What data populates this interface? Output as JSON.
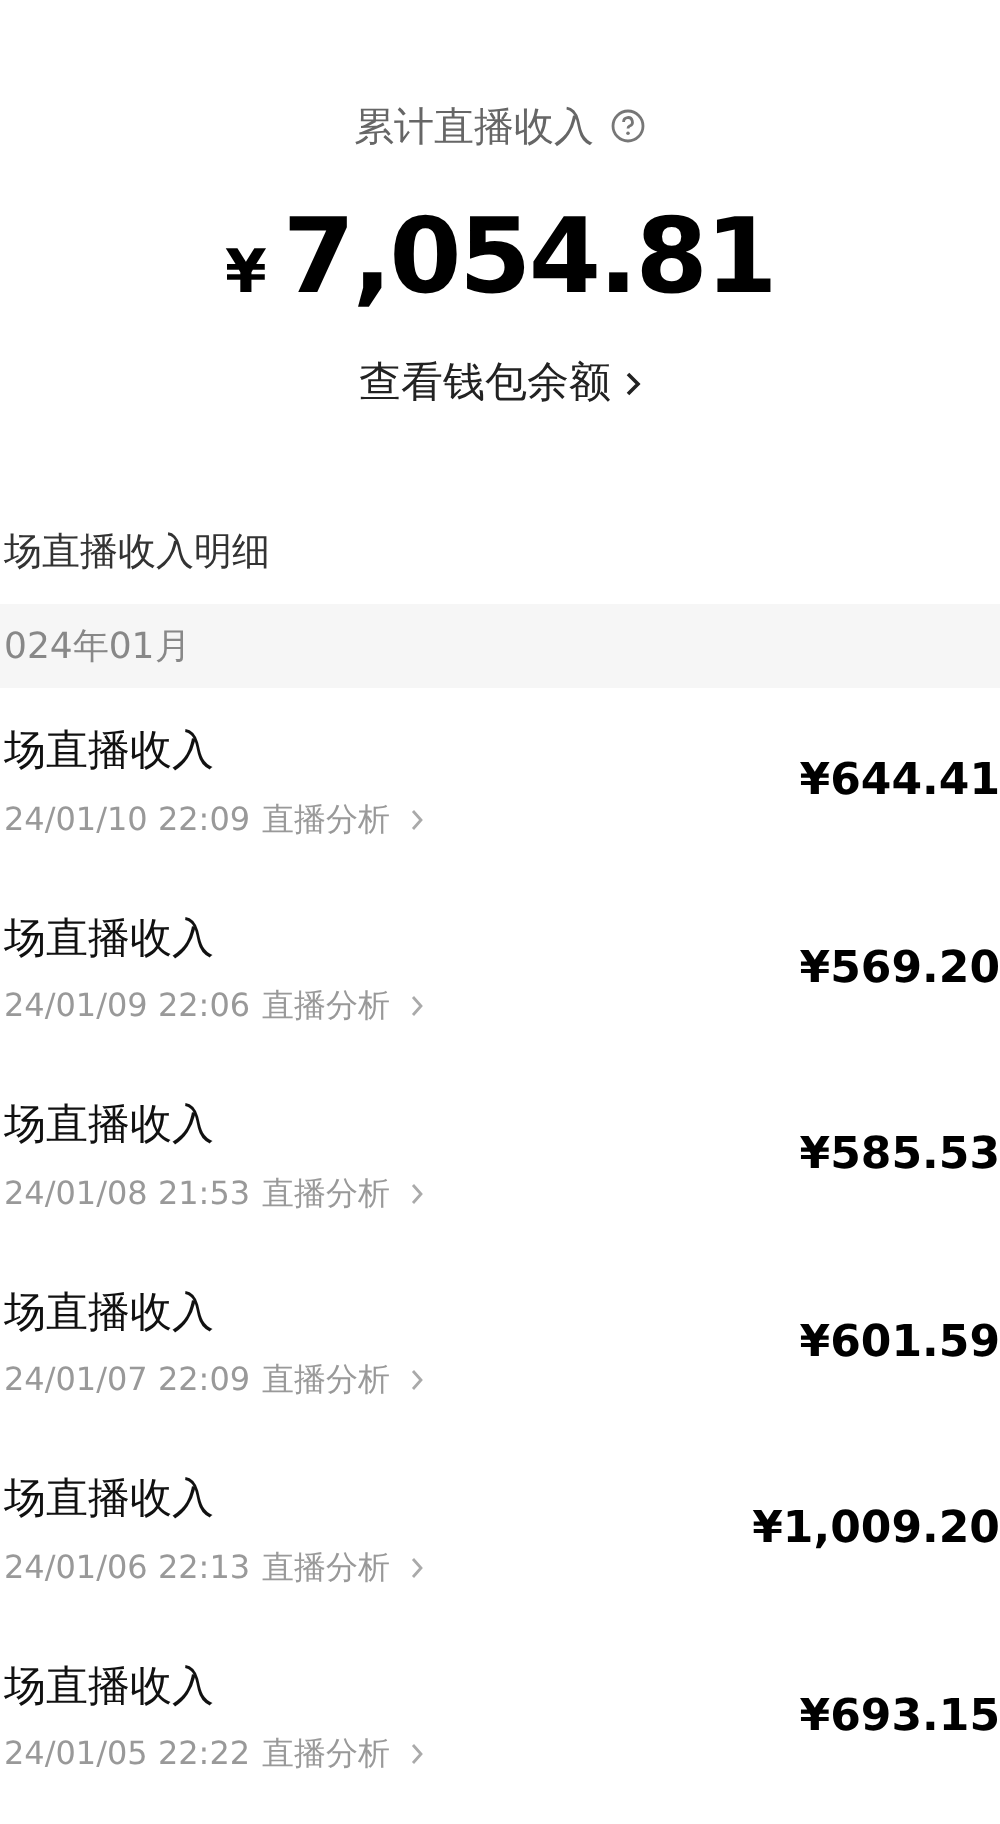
{
  "summary": {
    "title": "累计直播收入",
    "amount_symbol": "¥",
    "amount": "7,054.81",
    "wallet_link": "查看钱包余额"
  },
  "section_title": "场直播收入明细",
  "month": "024年01月",
  "records": [
    {
      "title": "场直播收入",
      "time": "24/01/10 22:09",
      "link": "直播分析",
      "amount": "¥644.41"
    },
    {
      "title": "场直播收入",
      "time": "24/01/09 22:06",
      "link": "直播分析",
      "amount": "¥569.20"
    },
    {
      "title": "场直播收入",
      "time": "24/01/08 21:53",
      "link": "直播分析",
      "amount": "¥585.53"
    },
    {
      "title": "场直播收入",
      "time": "24/01/07 22:09",
      "link": "直播分析",
      "amount": "¥601.59"
    },
    {
      "title": "场直播收入",
      "time": "24/01/06 22:13",
      "link": "直播分析",
      "amount": "¥1,009.20"
    },
    {
      "title": "场直播收入",
      "time": "24/01/05 22:22",
      "link": "直播分析",
      "amount": "¥693.15"
    }
  ]
}
